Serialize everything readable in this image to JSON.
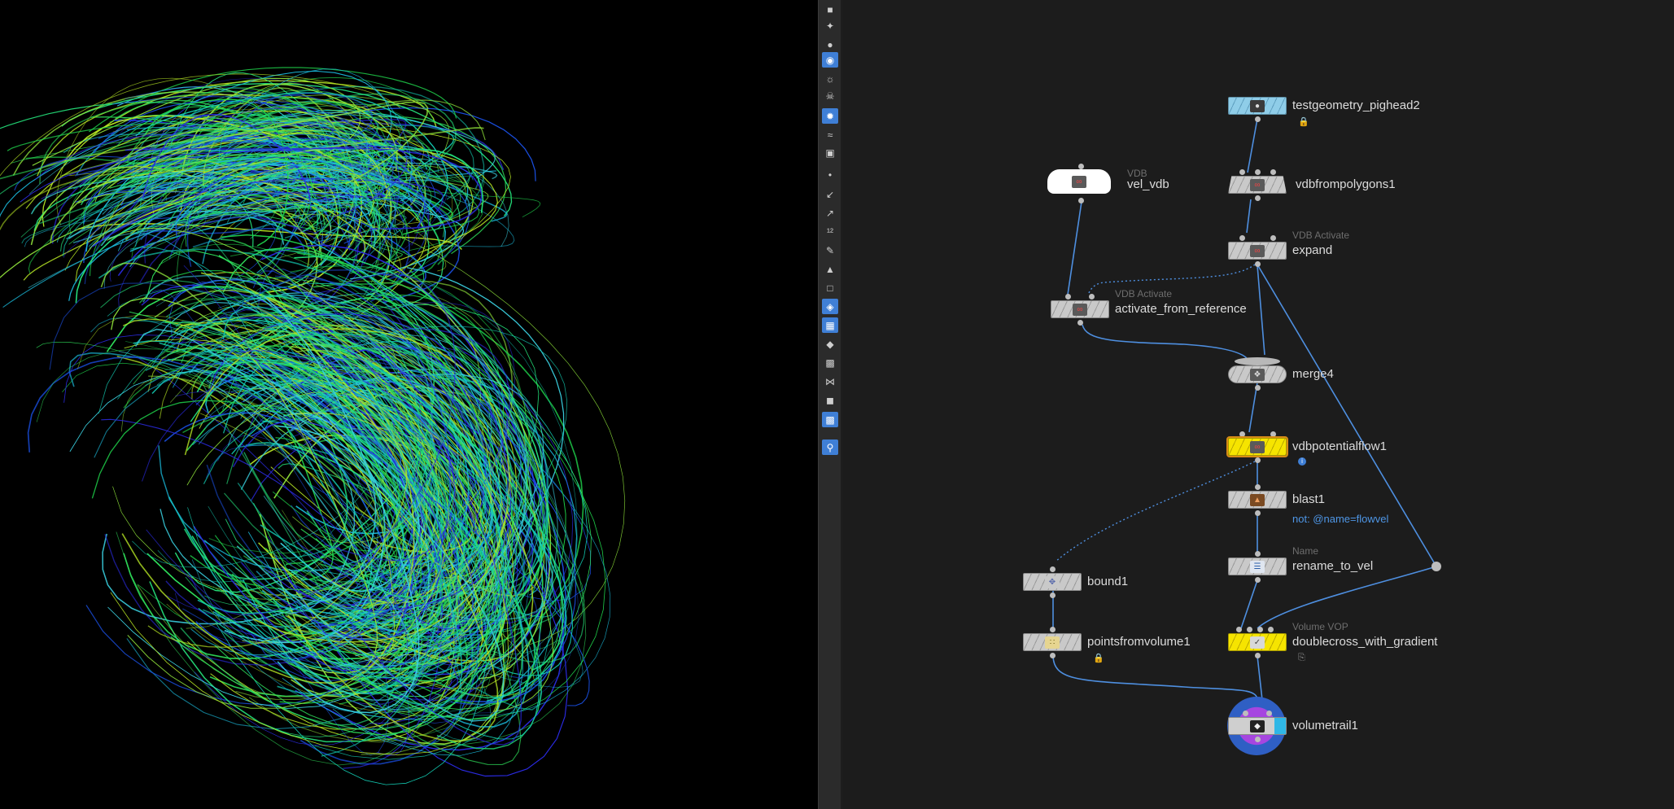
{
  "viewport": {
    "label": "3D viewport - velocity streamlines"
  },
  "toolbar": {
    "icons": [
      "lock-icon",
      "camera-icon",
      "sphere-icon",
      "light-icon",
      "bulb-icon",
      "skull-icon",
      "shading-icon",
      "ghost-icon",
      "display-icon",
      "point-icon",
      "normal-icon",
      "vector-icon",
      "numbers-icon",
      "brush-icon",
      "prim-icon",
      "bbox-icon",
      "snap-icon",
      "grid-icon",
      "persp-icon",
      "background-icon",
      "axes-icon",
      "stop-icon",
      "picture-icon",
      "pin-icon"
    ]
  },
  "nodes": {
    "testgeometry": {
      "name": "testgeometry_pighead2",
      "type": ""
    },
    "vel_vdb": {
      "name": "vel_vdb",
      "type": "VDB"
    },
    "vdbfrompolygons": {
      "name": "vdbfrompolygons1",
      "type": ""
    },
    "expand": {
      "name": "expand",
      "type": "VDB Activate"
    },
    "activate": {
      "name": "activate_from_reference",
      "type": "VDB Activate"
    },
    "merge": {
      "name": "merge4",
      "type": ""
    },
    "potentialflow": {
      "name": "vdbpotentialflow1",
      "type": ""
    },
    "blast": {
      "name": "blast1",
      "type": "",
      "comment": "not: @name=flowvel"
    },
    "rename": {
      "name": "rename_to_vel",
      "type": "Name"
    },
    "bound": {
      "name": "bound1",
      "type": ""
    },
    "pointsfromvolume": {
      "name": "pointsfromvolume1",
      "type": ""
    },
    "doublecross": {
      "name": "doublecross_with_gradient",
      "type": "Volume VOP"
    },
    "volumetrail": {
      "name": "volumetrail1",
      "type": ""
    }
  },
  "colors": {
    "network_bg": "#1c1c1c",
    "wire": "#4e8fe0",
    "yellow": "#f6e400",
    "selected": "#d88b16",
    "cyan": "#8fcde8"
  }
}
